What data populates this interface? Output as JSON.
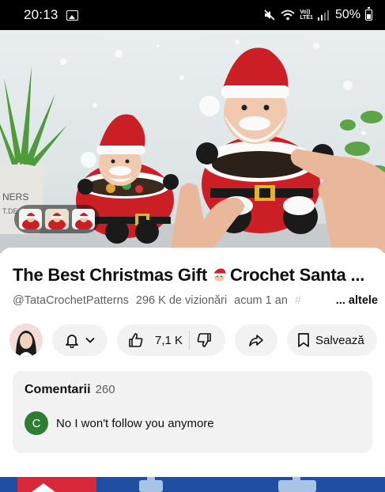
{
  "status_bar": {
    "time": "20:13",
    "network_line1": "Vo))",
    "network_line2": "LTE1",
    "battery": "50%",
    "icons": [
      "gallery-icon",
      "mute-icon",
      "wifi-icon",
      "signal-icon",
      "battery-icon"
    ]
  },
  "video": {
    "preview_thumbs": [
      "santa-thumb",
      "santa-thumb",
      "santa-thumb"
    ]
  },
  "title": {
    "text_before": "The Best Christmas Gift",
    "emoji": "santa-emoji",
    "text_after": "Crochet Santa ..."
  },
  "meta": {
    "channel": "@TataCrochetPatterns",
    "views": "296 K de vizionări",
    "age": "acum 1 an",
    "fade": "#",
    "more": "... altele"
  },
  "actions": {
    "like_count": "7,1 K",
    "save_label": "Salvează"
  },
  "comments": {
    "heading": "Comentarii",
    "count": "260",
    "top_comment": {
      "avatar_letter": "C",
      "avatar_color": "#2e7d32",
      "text": "No I won't follow you anymore"
    }
  },
  "colors": {
    "status_bar_bg": "#000000",
    "pill_bg": "#f2f2f2",
    "text_secondary": "#606060",
    "banner_bg": "#1e4fa0"
  }
}
